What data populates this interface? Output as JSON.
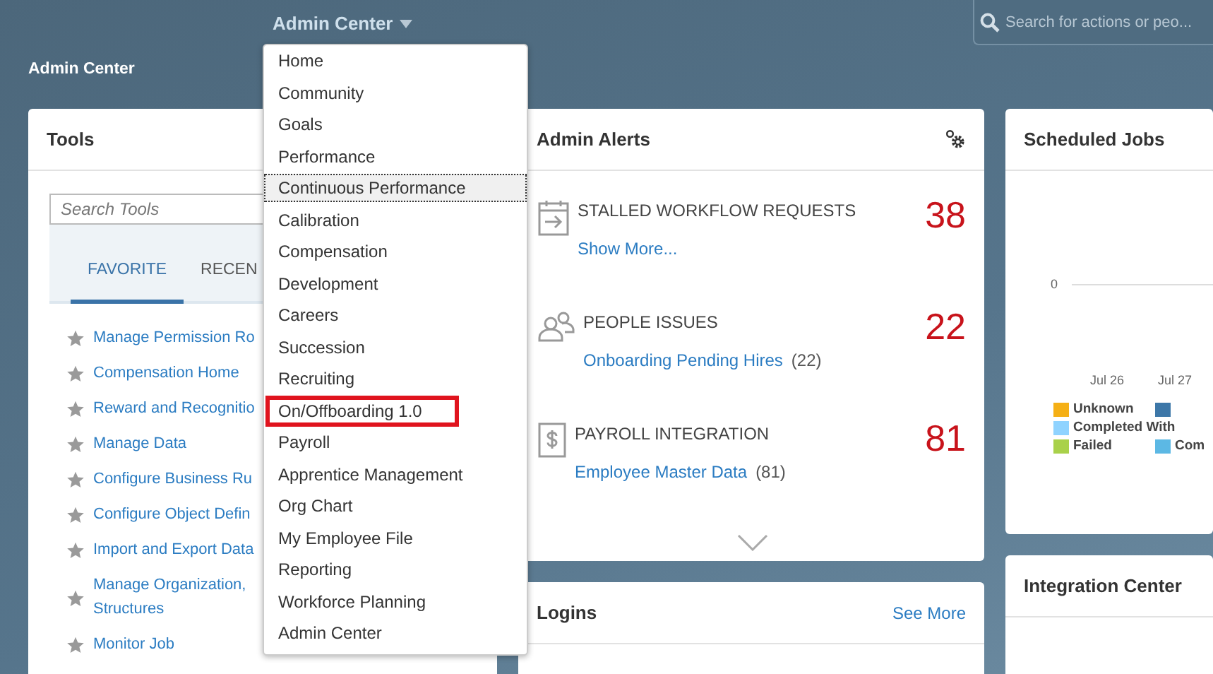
{
  "header": {
    "menu_title": "Admin Center",
    "search": {
      "placeholder": "Search for actions or peo..."
    }
  },
  "page_title": "Admin Center",
  "menu": [
    {
      "label": "Home",
      "selected": false,
      "highlighted": false
    },
    {
      "label": "Community",
      "selected": false,
      "highlighted": false
    },
    {
      "label": "Goals",
      "selected": false,
      "highlighted": false
    },
    {
      "label": "Performance",
      "selected": false,
      "highlighted": false
    },
    {
      "label": "Continuous Performance",
      "selected": true,
      "highlighted": false
    },
    {
      "label": "Calibration",
      "selected": false,
      "highlighted": false
    },
    {
      "label": "Compensation",
      "selected": false,
      "highlighted": false
    },
    {
      "label": "Development",
      "selected": false,
      "highlighted": false
    },
    {
      "label": "Careers",
      "selected": false,
      "highlighted": false
    },
    {
      "label": "Succession",
      "selected": false,
      "highlighted": false
    },
    {
      "label": "Recruiting",
      "selected": false,
      "highlighted": false
    },
    {
      "label": "On/Offboarding 1.0",
      "selected": false,
      "highlighted": true
    },
    {
      "label": "Payroll",
      "selected": false,
      "highlighted": false
    },
    {
      "label": "Apprentice Management",
      "selected": false,
      "highlighted": false
    },
    {
      "label": "Org Chart",
      "selected": false,
      "highlighted": false
    },
    {
      "label": "My Employee File",
      "selected": false,
      "highlighted": false
    },
    {
      "label": "Reporting",
      "selected": false,
      "highlighted": false
    },
    {
      "label": "Workforce Planning",
      "selected": false,
      "highlighted": false
    },
    {
      "label": "Admin Center",
      "selected": false,
      "highlighted": false
    }
  ],
  "tools": {
    "title": "Tools",
    "search": {
      "placeholder": "Search Tools"
    },
    "tabs": [
      {
        "label": "FAVORITE",
        "selected": true
      },
      {
        "label": "RECEN",
        "selected": false
      }
    ],
    "items": [
      {
        "lines": [
          "Manage Permission Ro"
        ]
      },
      {
        "lines": [
          "Compensation Home"
        ]
      },
      {
        "lines": [
          "Reward and Recognitio"
        ]
      },
      {
        "lines": [
          "Manage Data"
        ]
      },
      {
        "lines": [
          "Configure Business Ru"
        ]
      },
      {
        "lines": [
          "Configure Object Defin"
        ]
      },
      {
        "lines": [
          "Import and Export Data"
        ]
      },
      {
        "lines": [
          "Manage Organization,",
          "Structures"
        ]
      },
      {
        "lines": [
          "Monitor Job"
        ]
      }
    ]
  },
  "admin_alerts": {
    "title": "Admin Alerts",
    "alerts": [
      {
        "kind": "calendar",
        "title": "STALLED WORKFLOW REQUESTS",
        "count": "38",
        "link": "Show More..."
      },
      {
        "kind": "people",
        "title": "PEOPLE ISSUES",
        "count": "22",
        "link": "Onboarding Pending Hires",
        "link_count": "(22)"
      },
      {
        "kind": "dollar",
        "title": "PAYROLL INTEGRATION",
        "count": "81",
        "link": "Employee Master Data",
        "link_count": "(81)"
      }
    ]
  },
  "logins": {
    "title": "Logins",
    "action": "See More"
  },
  "scheduled_jobs": {
    "title": "Scheduled Jobs",
    "y_tick": "0",
    "x_labels": [
      "Jul 26",
      "Jul 27"
    ],
    "legend": [
      {
        "name": "Unknown",
        "color": "#f5b016"
      },
      {
        "color": "#3d77a8"
      },
      {
        "name": "Completed With",
        "color": "#8fd3ff"
      },
      {
        "name": "Failed",
        "color": "#a9d14a"
      },
      {
        "name": "Com",
        "color": "#5cb8e4"
      }
    ]
  },
  "integration_center": {
    "title": "Integration Center"
  }
}
